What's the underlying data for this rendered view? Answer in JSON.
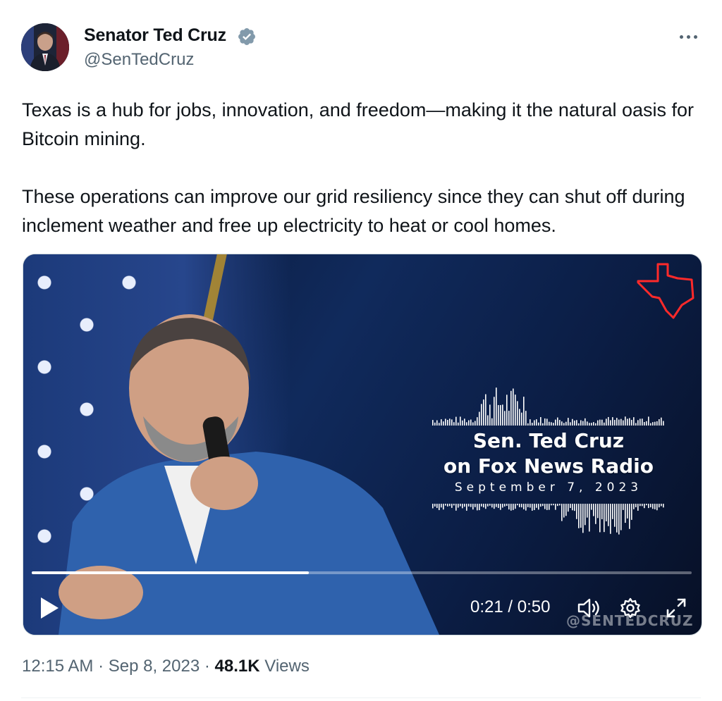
{
  "author": {
    "display_name": "Senator Ted Cruz",
    "handle": "@SenTedCruz",
    "verified": true,
    "verified_color": "#829aab"
  },
  "tweet": {
    "paragraphs": [
      "Texas is a hub for jobs, innovation, and freedom—making it the natural oasis for Bitcoin mining.",
      "These operations can improve our grid resiliency since they can shut off during inclement weather and free up electricity to heat or cool homes."
    ]
  },
  "video": {
    "title_line1": "Sen. Ted Cruz",
    "title_line2": "on Fox News Radio",
    "date": "September 7, 2023",
    "watermark": "@SENTEDCRUZ",
    "time_display": "0:21 / 0:50",
    "progress": 0.42
  },
  "meta": {
    "time": "12:15 AM",
    "date": "Sep 8, 2023",
    "views_count": "48.1K",
    "views_label": "Views",
    "separator": "·"
  },
  "icons": [
    "verified-badge-icon",
    "more-icon",
    "play-icon",
    "volume-icon",
    "gear-icon",
    "fullscreen-icon",
    "texas-outline-icon"
  ]
}
